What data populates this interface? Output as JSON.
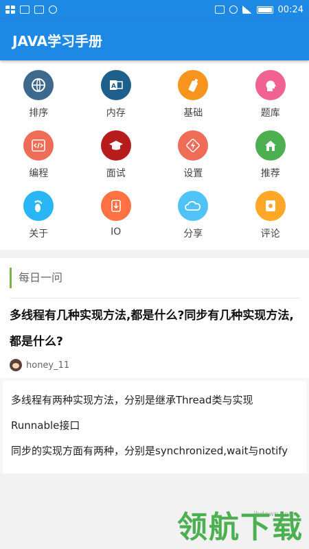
{
  "status_bar": {
    "time": "00:24",
    "icons": [
      "grid-icon",
      "usb-icon",
      "app-s-icon",
      "chat-icon",
      "vibrate-icon",
      "wifi-icon",
      "signal-icon",
      "battery-icon"
    ]
  },
  "app_bar": {
    "title": "JAVA学习手册"
  },
  "grid": [
    {
      "label": "排序",
      "icon": "globe-icon",
      "color": "#3d6a8c"
    },
    {
      "label": "内存",
      "icon": "outlook-icon",
      "color": "#1f5f8b"
    },
    {
      "label": "基础",
      "icon": "bottle-icon",
      "color": "#f7941d"
    },
    {
      "label": "题库",
      "icon": "head-icon",
      "color": "#f06292"
    },
    {
      "label": "编程",
      "icon": "code-icon",
      "color": "#ef6c57"
    },
    {
      "label": "面试",
      "icon": "graduation-cap-icon",
      "color": "#b71c1c"
    },
    {
      "label": "设置",
      "icon": "flash-icon",
      "color": "#ef6c57"
    },
    {
      "label": "推荐",
      "icon": "home-icon",
      "color": "#4caf50"
    },
    {
      "label": "关于",
      "icon": "footprint-icon",
      "color": "#29b6f6"
    },
    {
      "label": "IO",
      "icon": "download-icon",
      "color": "#ff7043"
    },
    {
      "label": "分享",
      "icon": "cloud-icon",
      "color": "#4fc3f7"
    },
    {
      "label": "评论",
      "icon": "comment-icon",
      "color": "#ffa726"
    }
  ],
  "daily": {
    "heading": "每日一问",
    "accent_color": "#7cb342",
    "question": "多线程有几种实现方法,都是什么?同步有几种实现方法,都是什么?",
    "author": "honey_11",
    "answer_lines": [
      "多线程有两种实现方法，分别是继承Thread类与实现Runnable接口",
      "同步的实现方面有两种，分别是synchronized,wait与notify"
    ]
  },
  "watermark": {
    "url": "lhdown.com",
    "text": "领航下载"
  }
}
